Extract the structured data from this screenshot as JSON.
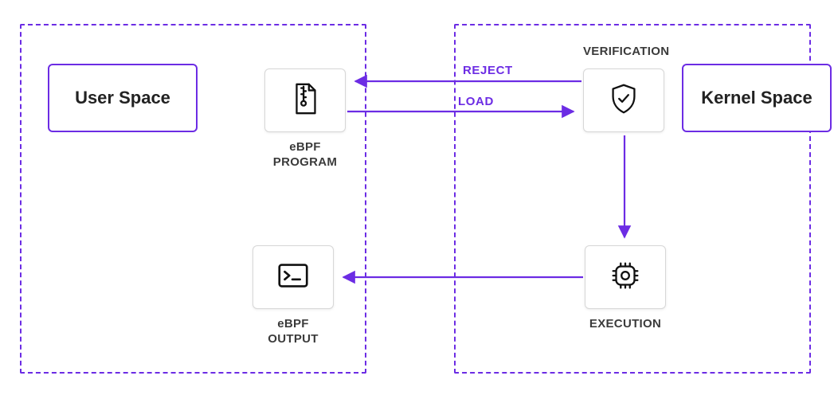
{
  "regions": {
    "user_space_title": "User Space",
    "kernel_space_title": "Kernel Space"
  },
  "nodes": {
    "ebpf_program": {
      "label": "eBPF\nPROGRAM",
      "icon": "zip-file-icon"
    },
    "verification": {
      "label": "VERIFICATION",
      "icon": "shield-check-icon"
    },
    "ebpf_output": {
      "label": "eBPF\nOUTPUT",
      "icon": "terminal-icon"
    },
    "execution": {
      "label": "EXECUTION",
      "icon": "cpu-chip-icon"
    }
  },
  "arrows": {
    "reject_label": "REJECT",
    "load_label": "LOAD"
  },
  "colors": {
    "accent": "#6C2CE4",
    "node_border": "#d7d7d7",
    "text": "#3b3b3b"
  }
}
